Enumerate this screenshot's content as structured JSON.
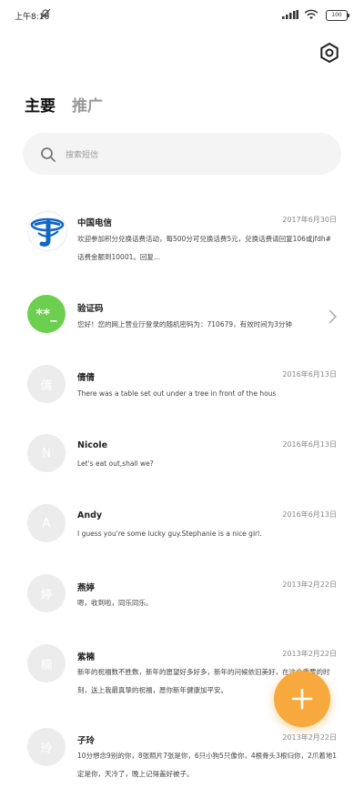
{
  "status_bar": {
    "time": "上午8:16",
    "battery": "100"
  },
  "tabs": [
    {
      "label": "主要",
      "active": true
    },
    {
      "label": "推广",
      "active": false
    }
  ],
  "search": {
    "placeholder": "搜索短信"
  },
  "messages": [
    {
      "sender": "中国电信",
      "date": "2017年6月30日",
      "preview": "欢迎参加积分兑换话费活动，每500分可兑换话费5元，兑换话费请回复106或jfdh#话费金额到10001。回复…",
      "avatar_type": "china-telecom-logo",
      "avatar_text": ""
    },
    {
      "sender": "验证码",
      "date": "",
      "preview": "您好！您的网上营业厅登录的随机密码为：710679，有效时间为3分钟",
      "avatar_type": "verification-code",
      "avatar_text": "**_",
      "avatar_color": "#6ccf4f"
    },
    {
      "sender": "倩倩",
      "date": "2016年6月13日",
      "preview": "There was a table set out under a tree in front of the hous",
      "avatar_type": "initial",
      "avatar_text": "倩"
    },
    {
      "sender": "Nicole",
      "date": "2016年6月13日",
      "preview": "Let's eat out,shall we?",
      "avatar_type": "initial",
      "avatar_text": "N"
    },
    {
      "sender": "Andy",
      "date": "2016年6月13日",
      "preview": "I guess you're some lucky guy.Stephanie is a nice girl.",
      "avatar_type": "initial",
      "avatar_text": "A"
    },
    {
      "sender": "燕婷",
      "date": "2013年2月22日",
      "preview": "嗯，收到啦，同乐同乐。",
      "avatar_type": "initial",
      "avatar_text": "婷"
    },
    {
      "sender": "紫楠",
      "date": "2013年2月22日",
      "preview": "新年的祝福数不胜数，新年的愿望好多好多，新年的问候依旧美好，在这个重要的时刻，送上我最真挚的祝福，愿你新年健康加平安。",
      "avatar_type": "initial",
      "avatar_text": "楠"
    },
    {
      "sender": "子玲",
      "date": "2013年2月22日",
      "preview": "10分想念9别的你，8张照片7张是你，6只小狗5只像你，4根骨头3根归你，2爪着地1定是你，天冷了，晚上记得盖好被子。",
      "avatar_type": "initial",
      "avatar_text": "玲"
    }
  ],
  "fab": {
    "icon": "plus-icon",
    "color": "#f7a93d"
  },
  "colors": {
    "accent": "#f7a93d",
    "avatar_placeholder": "#ececec",
    "verification_avatar": "#6ccf4f",
    "telecom_blue": "#1266c4"
  }
}
